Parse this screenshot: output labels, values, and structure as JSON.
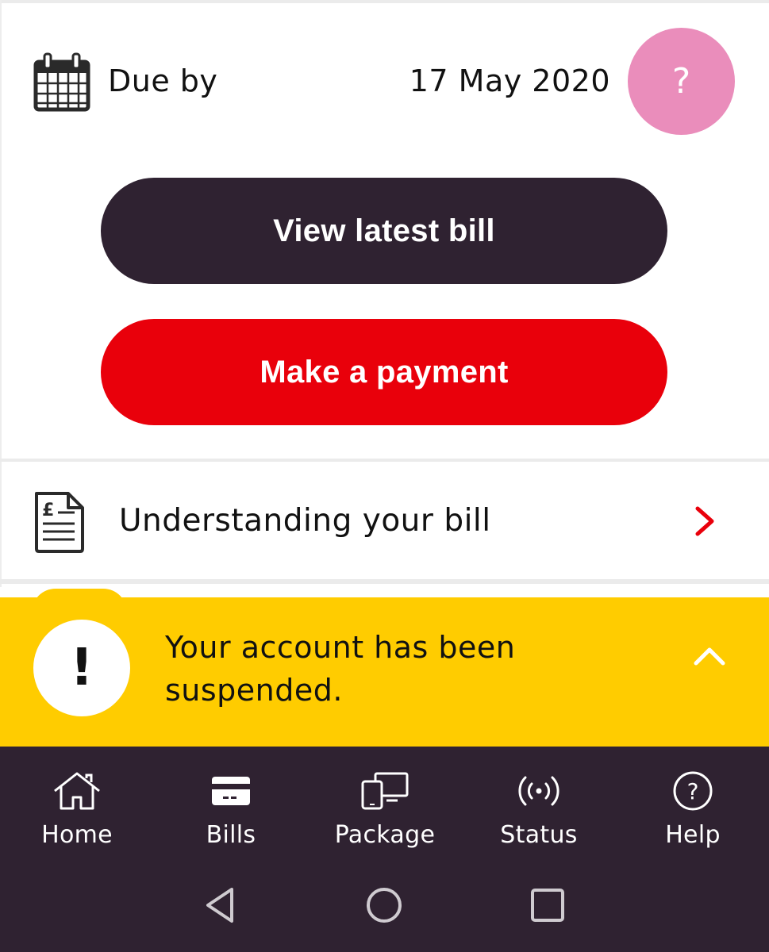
{
  "due": {
    "label": "Due by",
    "date": "17 May 2020",
    "calendar_icon": "calendar-icon"
  },
  "help_bubble": {
    "symbol": "?",
    "color": "#ea8dbb"
  },
  "buttons": {
    "view_bill_label": "View latest bill",
    "view_bill_color": "#2f2231",
    "payment_label": "Make a payment",
    "payment_color": "#e9000b"
  },
  "understanding": {
    "label": "Understanding your bill",
    "icon": "bill-document-icon",
    "chevron_color": "#e9000b"
  },
  "banner": {
    "message": "Your account has been suspended.",
    "alert_symbol": "!",
    "color": "#ffcc00"
  },
  "bottom_nav": {
    "background": "#2f2231",
    "items": [
      {
        "label": "Home",
        "icon": "home-icon"
      },
      {
        "label": "Bills",
        "icon": "card-icon"
      },
      {
        "label": "Package",
        "icon": "devices-icon"
      },
      {
        "label": "Status",
        "icon": "signal-icon"
      },
      {
        "label": "Help",
        "icon": "help-circle-icon"
      }
    ]
  }
}
